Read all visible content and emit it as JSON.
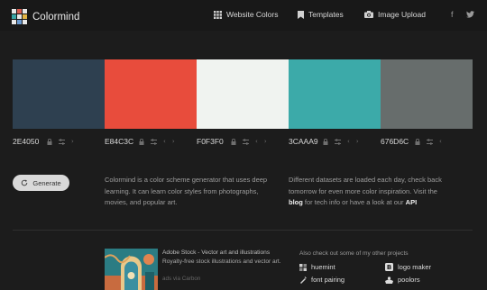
{
  "header": {
    "logo_text": "Colormind",
    "logo_colors": [
      "#e8e8e8",
      "#d85c4f",
      "#e8e8e8",
      "#3aa6a6",
      "#e8e8e8",
      "#e3b444",
      "#e8e8e8",
      "#6b9bd2",
      "#e8e8e8"
    ],
    "nav": {
      "website_colors": "Website Colors",
      "templates": "Templates",
      "image_upload": "Image Upload"
    },
    "social": {
      "facebook": "f",
      "twitter": "twitter-icon"
    }
  },
  "palette": {
    "swatches": [
      {
        "hex": "2E4050",
        "color": "#2E4050"
      },
      {
        "hex": "E84C3C",
        "color": "#E84C3C"
      },
      {
        "hex": "F0F3F0",
        "color": "#F0F3F0"
      },
      {
        "hex": "3CAAA9",
        "color": "#3CAAA9"
      },
      {
        "hex": "676D6C",
        "color": "#676D6C"
      }
    ]
  },
  "generate_label": "Generate",
  "description_left": "Colormind is a color scheme generator that uses deep learning. It can learn color styles from photographs, movies, and popular art.",
  "description_right": {
    "part1": "Different datasets are loaded each day, check back tomorrow for even more color inspiration. Visit the ",
    "blog_link": "blog",
    "part2": " for tech info or have a look at our ",
    "api_link": "API"
  },
  "ad": {
    "title": "Adobe Stock - Vector art and illustrations",
    "body": "Royalty-free stock illustrations and vector art.",
    "via": "ads via Carbon"
  },
  "other_projects": {
    "title": "Also check out some of my other projects",
    "items": [
      {
        "label": "huemint",
        "icon": "huemint-icon"
      },
      {
        "label": "logo maker",
        "icon": "logo-maker-icon"
      },
      {
        "label": "font pairing",
        "icon": "font-pairing-icon"
      },
      {
        "label": "poolors",
        "icon": "poolors-icon"
      }
    ]
  }
}
